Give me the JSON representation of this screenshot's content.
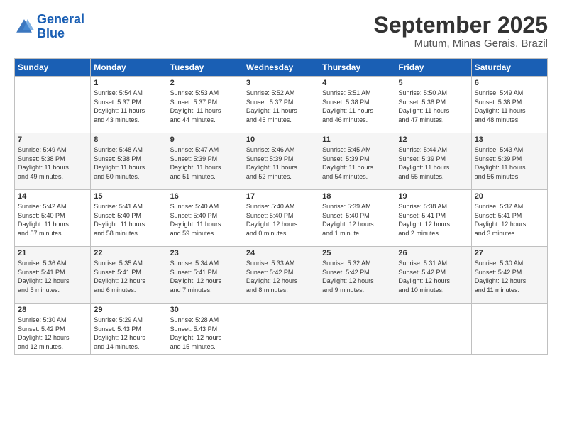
{
  "logo": {
    "line1": "General",
    "line2": "Blue"
  },
  "calendar": {
    "title": "September 2025",
    "subtitle": "Mutum, Minas Gerais, Brazil"
  },
  "weekdays": [
    "Sunday",
    "Monday",
    "Tuesday",
    "Wednesday",
    "Thursday",
    "Friday",
    "Saturday"
  ],
  "weeks": [
    [
      {
        "day": "",
        "info": ""
      },
      {
        "day": "1",
        "info": "Sunrise: 5:54 AM\nSunset: 5:37 PM\nDaylight: 11 hours\nand 43 minutes."
      },
      {
        "day": "2",
        "info": "Sunrise: 5:53 AM\nSunset: 5:37 PM\nDaylight: 11 hours\nand 44 minutes."
      },
      {
        "day": "3",
        "info": "Sunrise: 5:52 AM\nSunset: 5:37 PM\nDaylight: 11 hours\nand 45 minutes."
      },
      {
        "day": "4",
        "info": "Sunrise: 5:51 AM\nSunset: 5:38 PM\nDaylight: 11 hours\nand 46 minutes."
      },
      {
        "day": "5",
        "info": "Sunrise: 5:50 AM\nSunset: 5:38 PM\nDaylight: 11 hours\nand 47 minutes."
      },
      {
        "day": "6",
        "info": "Sunrise: 5:49 AM\nSunset: 5:38 PM\nDaylight: 11 hours\nand 48 minutes."
      }
    ],
    [
      {
        "day": "7",
        "info": "Sunrise: 5:49 AM\nSunset: 5:38 PM\nDaylight: 11 hours\nand 49 minutes."
      },
      {
        "day": "8",
        "info": "Sunrise: 5:48 AM\nSunset: 5:38 PM\nDaylight: 11 hours\nand 50 minutes."
      },
      {
        "day": "9",
        "info": "Sunrise: 5:47 AM\nSunset: 5:39 PM\nDaylight: 11 hours\nand 51 minutes."
      },
      {
        "day": "10",
        "info": "Sunrise: 5:46 AM\nSunset: 5:39 PM\nDaylight: 11 hours\nand 52 minutes."
      },
      {
        "day": "11",
        "info": "Sunrise: 5:45 AM\nSunset: 5:39 PM\nDaylight: 11 hours\nand 54 minutes."
      },
      {
        "day": "12",
        "info": "Sunrise: 5:44 AM\nSunset: 5:39 PM\nDaylight: 11 hours\nand 55 minutes."
      },
      {
        "day": "13",
        "info": "Sunrise: 5:43 AM\nSunset: 5:39 PM\nDaylight: 11 hours\nand 56 minutes."
      }
    ],
    [
      {
        "day": "14",
        "info": "Sunrise: 5:42 AM\nSunset: 5:40 PM\nDaylight: 11 hours\nand 57 minutes."
      },
      {
        "day": "15",
        "info": "Sunrise: 5:41 AM\nSunset: 5:40 PM\nDaylight: 11 hours\nand 58 minutes."
      },
      {
        "day": "16",
        "info": "Sunrise: 5:40 AM\nSunset: 5:40 PM\nDaylight: 11 hours\nand 59 minutes."
      },
      {
        "day": "17",
        "info": "Sunrise: 5:40 AM\nSunset: 5:40 PM\nDaylight: 12 hours\nand 0 minutes."
      },
      {
        "day": "18",
        "info": "Sunrise: 5:39 AM\nSunset: 5:40 PM\nDaylight: 12 hours\nand 1 minute."
      },
      {
        "day": "19",
        "info": "Sunrise: 5:38 AM\nSunset: 5:41 PM\nDaylight: 12 hours\nand 2 minutes."
      },
      {
        "day": "20",
        "info": "Sunrise: 5:37 AM\nSunset: 5:41 PM\nDaylight: 12 hours\nand 3 minutes."
      }
    ],
    [
      {
        "day": "21",
        "info": "Sunrise: 5:36 AM\nSunset: 5:41 PM\nDaylight: 12 hours\nand 5 minutes."
      },
      {
        "day": "22",
        "info": "Sunrise: 5:35 AM\nSunset: 5:41 PM\nDaylight: 12 hours\nand 6 minutes."
      },
      {
        "day": "23",
        "info": "Sunrise: 5:34 AM\nSunset: 5:41 PM\nDaylight: 12 hours\nand 7 minutes."
      },
      {
        "day": "24",
        "info": "Sunrise: 5:33 AM\nSunset: 5:42 PM\nDaylight: 12 hours\nand 8 minutes."
      },
      {
        "day": "25",
        "info": "Sunrise: 5:32 AM\nSunset: 5:42 PM\nDaylight: 12 hours\nand 9 minutes."
      },
      {
        "day": "26",
        "info": "Sunrise: 5:31 AM\nSunset: 5:42 PM\nDaylight: 12 hours\nand 10 minutes."
      },
      {
        "day": "27",
        "info": "Sunrise: 5:30 AM\nSunset: 5:42 PM\nDaylight: 12 hours\nand 11 minutes."
      }
    ],
    [
      {
        "day": "28",
        "info": "Sunrise: 5:30 AM\nSunset: 5:42 PM\nDaylight: 12 hours\nand 12 minutes."
      },
      {
        "day": "29",
        "info": "Sunrise: 5:29 AM\nSunset: 5:43 PM\nDaylight: 12 hours\nand 14 minutes."
      },
      {
        "day": "30",
        "info": "Sunrise: 5:28 AM\nSunset: 5:43 PM\nDaylight: 12 hours\nand 15 minutes."
      },
      {
        "day": "",
        "info": ""
      },
      {
        "day": "",
        "info": ""
      },
      {
        "day": "",
        "info": ""
      },
      {
        "day": "",
        "info": ""
      }
    ]
  ]
}
